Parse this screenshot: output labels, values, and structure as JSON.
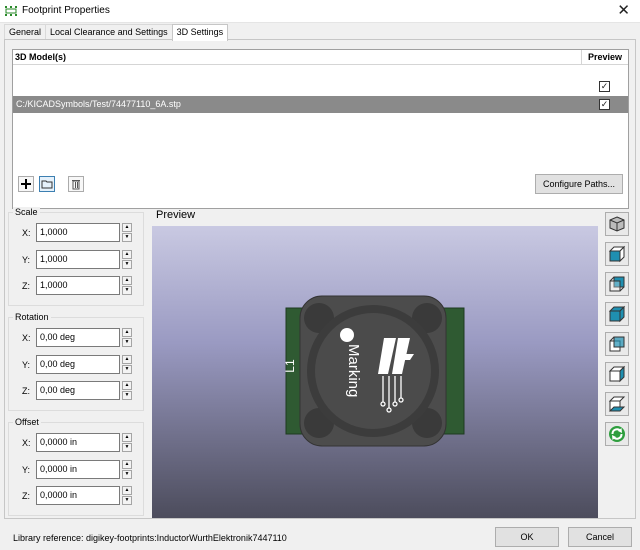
{
  "window": {
    "title": "Footprint Properties",
    "close": "✕"
  },
  "tabs": [
    {
      "label": "General"
    },
    {
      "label": "Local Clearance and Settings"
    },
    {
      "label": "3D Settings"
    }
  ],
  "models": {
    "col_model": "3D Model(s)",
    "col_preview": "Preview",
    "rows": [
      {
        "path": "",
        "preview_checked": true
      },
      {
        "path": "C:/KICADSymbols/Test/74477110_6A.stp",
        "preview_checked": true
      }
    ],
    "add_icon": "plus-icon",
    "browse_icon": "folder-icon",
    "delete_icon": "trash-icon",
    "configure_label": "Configure Paths..."
  },
  "scale": {
    "title": "Scale",
    "x_label": "X:",
    "x": "1,0000",
    "y_label": "Y:",
    "y": "1,0000",
    "z_label": "Z:",
    "z": "1,0000"
  },
  "rotation": {
    "title": "Rotation",
    "x_label": "X:",
    "x": "0,00 deg",
    "y_label": "Y:",
    "y": "0,00 deg",
    "z_label": "Z:",
    "z": "0,00 deg"
  },
  "offset": {
    "title": "Offset",
    "x_label": "X:",
    "x": "0,0000 in",
    "y_label": "Y:",
    "y": "0,0000 in",
    "z_label": "Z:",
    "z": "0,0000 in"
  },
  "preview": {
    "label": "Preview",
    "component_marking": "Marking",
    "ref_label": "L1"
  },
  "view_buttons": [
    "view-3d-icon",
    "view-front-icon",
    "view-back-icon",
    "view-top-icon",
    "view-bottom-icon",
    "view-left-icon",
    "view-right-icon",
    "reload-icon"
  ],
  "footer": {
    "status": "Library reference: digikey-footprints:InductorWurthElektronik7447110",
    "ok": "OK",
    "cancel": "Cancel"
  },
  "colors": {
    "selection": "#8a8a8a",
    "board": "#2f5a32",
    "body": "#4c4c4c",
    "accent": "#1f8fb0"
  }
}
